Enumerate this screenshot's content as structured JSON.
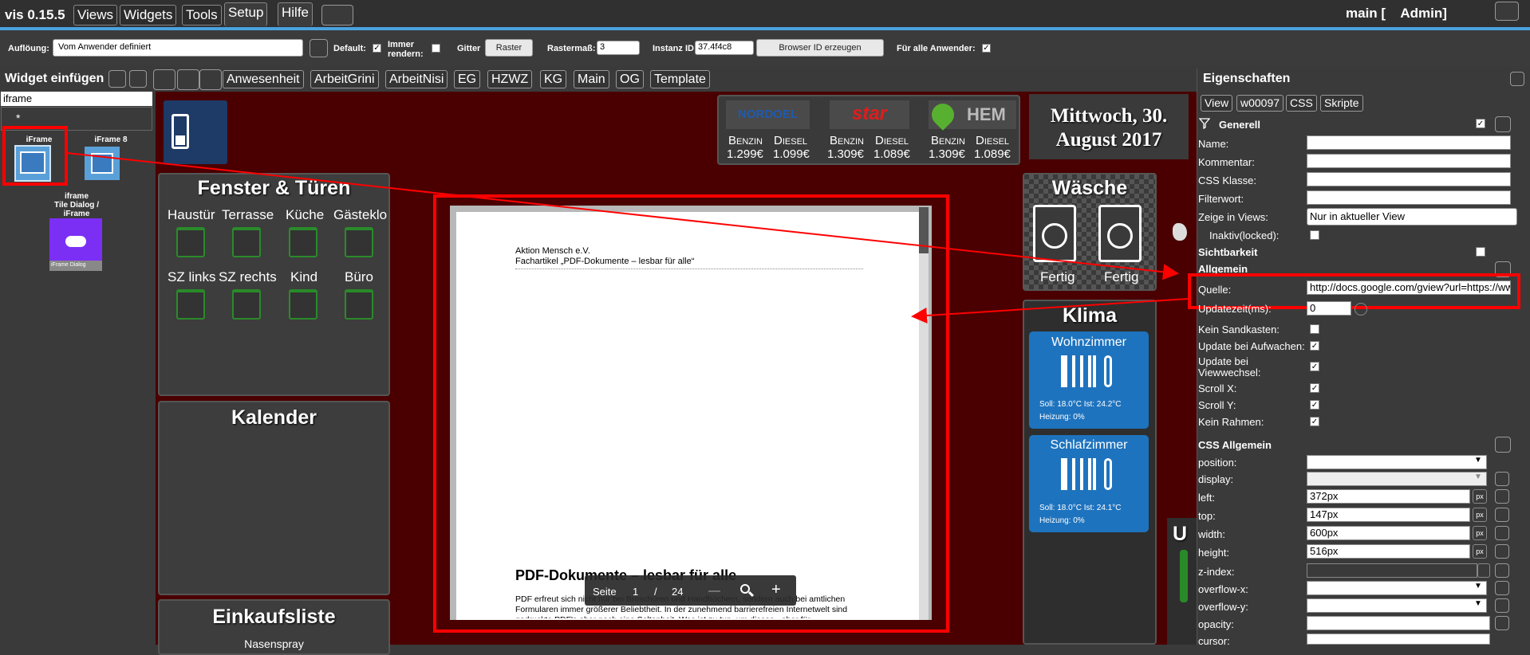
{
  "app": {
    "name": "vis 0.15.5",
    "user": "main [    Admin]"
  },
  "menu": [
    "Views",
    "Widgets",
    "Tools",
    "Setup",
    "Hilfe"
  ],
  "toolbar": {
    "resolution_label": "Auflöung:",
    "resolution_value": "Vom Anwender definiert",
    "default_label": "Default:",
    "always_render_label": "Immer rendern:",
    "grid_label": "Gitter",
    "grid_value": "Raster",
    "grid_size_label": "Rastermaß:",
    "grid_size_value": "3",
    "instance_label": "Instanz ID",
    "instance_value": "37.4f4c8",
    "browser_id_button": "Browser ID erzeugen",
    "all_users_label": "Für alle Anwender:"
  },
  "widget_insert": {
    "title": "Widget einfügen",
    "filter_value": "iframe",
    "star": "*"
  },
  "view_tabs": [
    "Anwesenheit",
    "ArbeitGrini",
    "ArbeitNisi",
    "EG",
    "HZWZ",
    "KG",
    "Main",
    "OG",
    "Template"
  ],
  "widgets": [
    {
      "label": "iFrame",
      "icon": "iframe-widget-icon"
    },
    {
      "label": "iFrame 8",
      "icon": "iframe8-widget-icon"
    },
    {
      "label": "iframe\nTile Dialog / iFrame",
      "caption": "iFrame Dialog",
      "icon": "cloud-icon"
    }
  ],
  "canvas": {
    "fuel": [
      {
        "brand": "NORDOEL",
        "benzin_label": "Benzin",
        "diesel_label": "Diesel",
        "benzin": "1.299€",
        "diesel": "1.099€"
      },
      {
        "brand": "star",
        "benzin_label": "Benzin",
        "diesel_label": "Diesel",
        "benzin": "1.309€",
        "diesel": "1.089€"
      },
      {
        "brand": "HEM",
        "benzin_label": "Benzin",
        "diesel_label": "Diesel",
        "benzin": "1.309€",
        "diesel": "1.089€"
      }
    ],
    "date_line1": "Mittwoch, 30.",
    "date_line2": "August 2017",
    "fenster": {
      "title": "Fenster & Türen",
      "rooms": [
        "Haustür",
        "Terrasse",
        "Küche",
        "Gästeklo",
        "SZ links",
        "SZ rechts",
        "Kind",
        "Büro"
      ]
    },
    "kalender": {
      "title": "Kalender"
    },
    "einkauf": {
      "title": "Einkaufsliste",
      "item": "Nasenspray"
    },
    "waesche": {
      "title": "Wäsche",
      "items": [
        "Fertig",
        "Fertig"
      ]
    },
    "klima": {
      "title": "Klima",
      "rooms": [
        {
          "name": "Wohnzimmer",
          "info1": "Soll: 18.0°C Ist: 24.2°C",
          "info2": "Heizung: 0%"
        },
        {
          "name": "Schlafzimmer",
          "info1": "Soll: 18.0°C Ist: 24.1°C",
          "info2": "Heizung: 0%"
        }
      ]
    },
    "u_label": "U",
    "document": {
      "header1": "Aktion Mensch e.V.",
      "header2": "Fachartikel „PDF-Dokumente – lesbar für alle“",
      "heading": "PDF-Dokumente – lesbar für alle",
      "para": "PDF erfreut sich nicht nur bei Broschüren und Handbüchern, sondern auch bei amtlichen Formularen immer größerer Beliebtheit. In der zunehmend barrierefreien Internetwelt sind gedruckte PDF's aber noch eine Seltenheit. Was ist zu tun, um dieses - aber für",
      "viewer_page_label": "Seite",
      "viewer_page": "1",
      "viewer_sep": "/",
      "viewer_total": "24",
      "viewer_minus": "—",
      "viewer_plus": "+"
    }
  },
  "properties": {
    "title": "Eigenschaften",
    "tabs": [
      "View",
      "w00097",
      "CSS",
      "Skripte"
    ],
    "general": "Generell",
    "fields": [
      {
        "label": "Name:",
        "value": ""
      },
      {
        "label": "Kommentar:",
        "value": ""
      },
      {
        "label": "CSS Klasse:",
        "value": ""
      },
      {
        "label": "Filterwort:",
        "value": ""
      },
      {
        "label": "Zeige in Views:",
        "value": "Nur in aktueller View"
      }
    ],
    "inactive_label": "Inaktiv(locked):",
    "visibility": "Sichtbarkeit",
    "allgemein": "Allgemein",
    "source_label": "Quelle:",
    "source_value": "http://docs.google.com/gview?url=https://www",
    "update_label": "Updatezeit(ms):",
    "update_value": "0",
    "checks": [
      "Kein Sandkasten:",
      "Update bei Aufwachen:",
      "Update bei Viewwechsel:",
      "Scroll X:",
      "Scroll Y:",
      "Kein Rahmen:"
    ],
    "css_general": "CSS Allgemein",
    "css": [
      {
        "label": "position:",
        "value": ""
      },
      {
        "label": "display:",
        "value": ""
      },
      {
        "label": "left:",
        "value": "372px"
      },
      {
        "label": "top:",
        "value": "147px"
      },
      {
        "label": "width:",
        "value": "600px"
      },
      {
        "label": "height:",
        "value": "516px"
      },
      {
        "label": "z-index:",
        "value": ""
      },
      {
        "label": "overflow-x:",
        "value": ""
      },
      {
        "label": "overflow-y:",
        "value": ""
      },
      {
        "label": "opacity:",
        "value": ""
      },
      {
        "label": "cursor:",
        "value": ""
      }
    ],
    "px_unit": "px"
  }
}
